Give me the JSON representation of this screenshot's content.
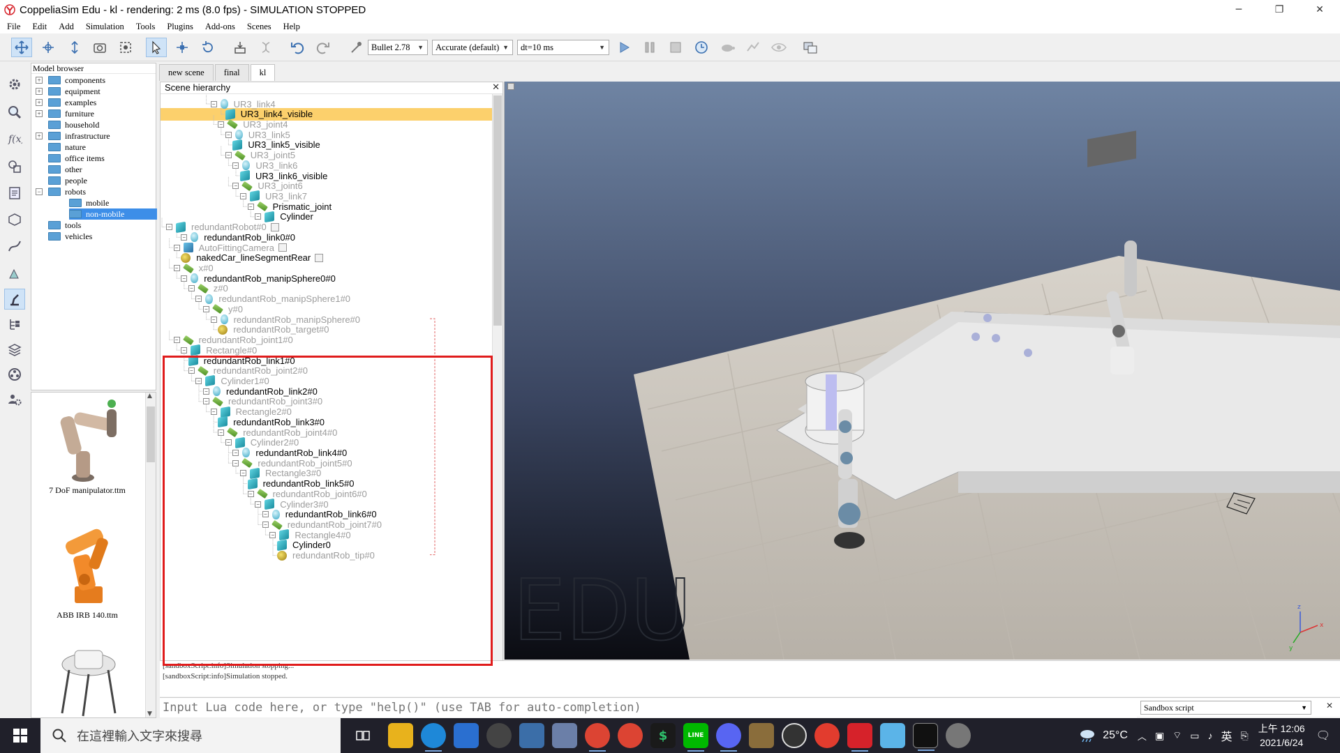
{
  "window": {
    "title": "CoppeliaSim Edu - kl - rendering: 2 ms (8.0 fps) - SIMULATION STOPPED",
    "minimize": "─",
    "restore": "❐",
    "close": "✕"
  },
  "menu": [
    "File",
    "Edit",
    "Add",
    "Simulation",
    "Tools",
    "Plugins",
    "Add-ons",
    "Scenes",
    "Help"
  ],
  "toolbar": {
    "engine": "Bullet 2.78",
    "accuracy": "Accurate (default)",
    "timestep": "dt=10 ms"
  },
  "model_browser": {
    "title": "Model browser",
    "items": [
      {
        "label": "components",
        "expander": "+"
      },
      {
        "label": "equipment",
        "expander": "+"
      },
      {
        "label": "examples",
        "expander": "+"
      },
      {
        "label": "furniture",
        "expander": "+"
      },
      {
        "label": "household",
        "expander": ""
      },
      {
        "label": "infrastructure",
        "expander": "+"
      },
      {
        "label": "nature",
        "expander": ""
      },
      {
        "label": "office items",
        "expander": ""
      },
      {
        "label": "other",
        "expander": ""
      },
      {
        "label": "people",
        "expander": ""
      },
      {
        "label": "robots",
        "expander": "−"
      },
      {
        "label": "mobile",
        "expander": ""
      },
      {
        "label": "non-mobile",
        "expander": "",
        "selected": true
      },
      {
        "label": "tools",
        "expander": ""
      },
      {
        "label": "vehicles",
        "expander": ""
      }
    ],
    "thumbnails": [
      "7 DoF manipulator.ttm",
      "ABB IRB 140.ttm"
    ]
  },
  "scene_tabs": [
    "new scene",
    "final",
    "kl"
  ],
  "active_tab": "kl",
  "hierarchy": {
    "title": "Scene hierarchy",
    "close": "✕",
    "rows": [
      {
        "label": "UR3_link4",
        "type": "sphere",
        "dim": true
      },
      {
        "label": "UR3_link4_visible",
        "type": "shape",
        "dim": false,
        "selected": true
      },
      {
        "label": "UR3_joint4",
        "type": "joint",
        "dim": true
      },
      {
        "label": "UR3_link5",
        "type": "sphere",
        "dim": true
      },
      {
        "label": "UR3_link5_visible",
        "type": "shape",
        "dim": false
      },
      {
        "label": "UR3_joint5",
        "type": "joint",
        "dim": true
      },
      {
        "label": "UR3_link6",
        "type": "sphere",
        "dim": true
      },
      {
        "label": "UR3_link6_visible",
        "type": "shape",
        "dim": false
      },
      {
        "label": "UR3_joint6",
        "type": "joint",
        "dim": true
      },
      {
        "label": "UR3_link7",
        "type": "cube",
        "dim": true
      },
      {
        "label": "Prismatic_joint",
        "type": "joint",
        "dim": false
      },
      {
        "label": "Cylinder",
        "type": "cube",
        "dim": false
      },
      {
        "label": "redundantRobot#0",
        "type": "cube",
        "dim": true
      },
      {
        "label": "redundantRob_link0#0",
        "type": "sphere",
        "dim": false
      },
      {
        "label": "AutoFittingCamera",
        "type": "camera",
        "dim": true
      },
      {
        "label": "nakedCar_lineSegmentRear",
        "type": "dummy",
        "dim": false
      },
      {
        "label": "x#0",
        "type": "joint",
        "dim": true
      },
      {
        "label": "redundantRob_manipSphere0#0",
        "type": "sphere",
        "dim": false
      },
      {
        "label": "z#0",
        "type": "joint",
        "dim": true
      },
      {
        "label": "redundantRob_manipSphere1#0",
        "type": "sphere",
        "dim": true
      },
      {
        "label": "y#0",
        "type": "joint",
        "dim": true
      },
      {
        "label": "redundantRob_manipSphere#0",
        "type": "sphere",
        "dim": true
      },
      {
        "label": "redundantRob_target#0",
        "type": "dummy",
        "dim": true
      },
      {
        "label": "redundantRob_joint1#0",
        "type": "joint",
        "dim": true
      },
      {
        "label": "Rectangle#0",
        "type": "cube",
        "dim": true
      },
      {
        "label": "redundantRob_link1#0",
        "type": "shape",
        "dim": false
      },
      {
        "label": "redundantRob_joint2#0",
        "type": "joint",
        "dim": true
      },
      {
        "label": "Cylinder1#0",
        "type": "cube",
        "dim": true
      },
      {
        "label": "redundantRob_link2#0",
        "type": "sphere",
        "dim": false
      },
      {
        "label": "redundantRob_joint3#0",
        "type": "joint",
        "dim": true
      },
      {
        "label": "Rectangle2#0",
        "type": "cube",
        "dim": true
      },
      {
        "label": "redundantRob_link3#0",
        "type": "shape",
        "dim": false
      },
      {
        "label": "redundantRob_joint4#0",
        "type": "joint",
        "dim": true
      },
      {
        "label": "Cylinder2#0",
        "type": "cube",
        "dim": true
      },
      {
        "label": "redundantRob_link4#0",
        "type": "sphere",
        "dim": false
      },
      {
        "label": "redundantRob_joint5#0",
        "type": "joint",
        "dim": true
      },
      {
        "label": "Rectangle3#0",
        "type": "cube",
        "dim": true
      },
      {
        "label": "redundantRob_link5#0",
        "type": "shape",
        "dim": false
      },
      {
        "label": "redundantRob_joint6#0",
        "type": "joint",
        "dim": true
      },
      {
        "label": "Cylinder3#0",
        "type": "cube",
        "dim": true
      },
      {
        "label": "redundantRob_link6#0",
        "type": "sphere",
        "dim": false
      },
      {
        "label": "redundantRob_joint7#0",
        "type": "joint",
        "dim": true
      },
      {
        "label": "Rectangle4#0",
        "type": "cube",
        "dim": true
      },
      {
        "label": "Cylinder0",
        "type": "shape",
        "dim": false
      },
      {
        "label": "redundantRob_tip#0",
        "type": "dummy",
        "dim": true
      }
    ]
  },
  "viewport": {
    "watermark": "EDU",
    "floor_color": "#cfcac2",
    "sky_top": "#6f84a3",
    "sky_bottom": "#0b0c12",
    "axes": {
      "x": "x",
      "y": "y",
      "z": "z"
    }
  },
  "console": {
    "lines": [
      "[sandboxScript:info]Simulation stopping...",
      "[sandboxScript:info]Simulation stopped."
    ]
  },
  "lua_bar": {
    "placeholder": "Input Lua code here, or type \"help()\" (use TAB for auto-completion)",
    "script_selector": "Sandbox script",
    "close": "✕"
  },
  "taskbar": {
    "search_placeholder": "在這裡輸入文字來搜尋",
    "temperature": "25°C",
    "ime": "英",
    "time": "上午 12:06",
    "date": "2021/6/24",
    "line_app": "LINE"
  },
  "colors": {
    "accent": "#3d8ee8",
    "selection": "#fcd06c",
    "highlight_box": "#e01c1c"
  }
}
